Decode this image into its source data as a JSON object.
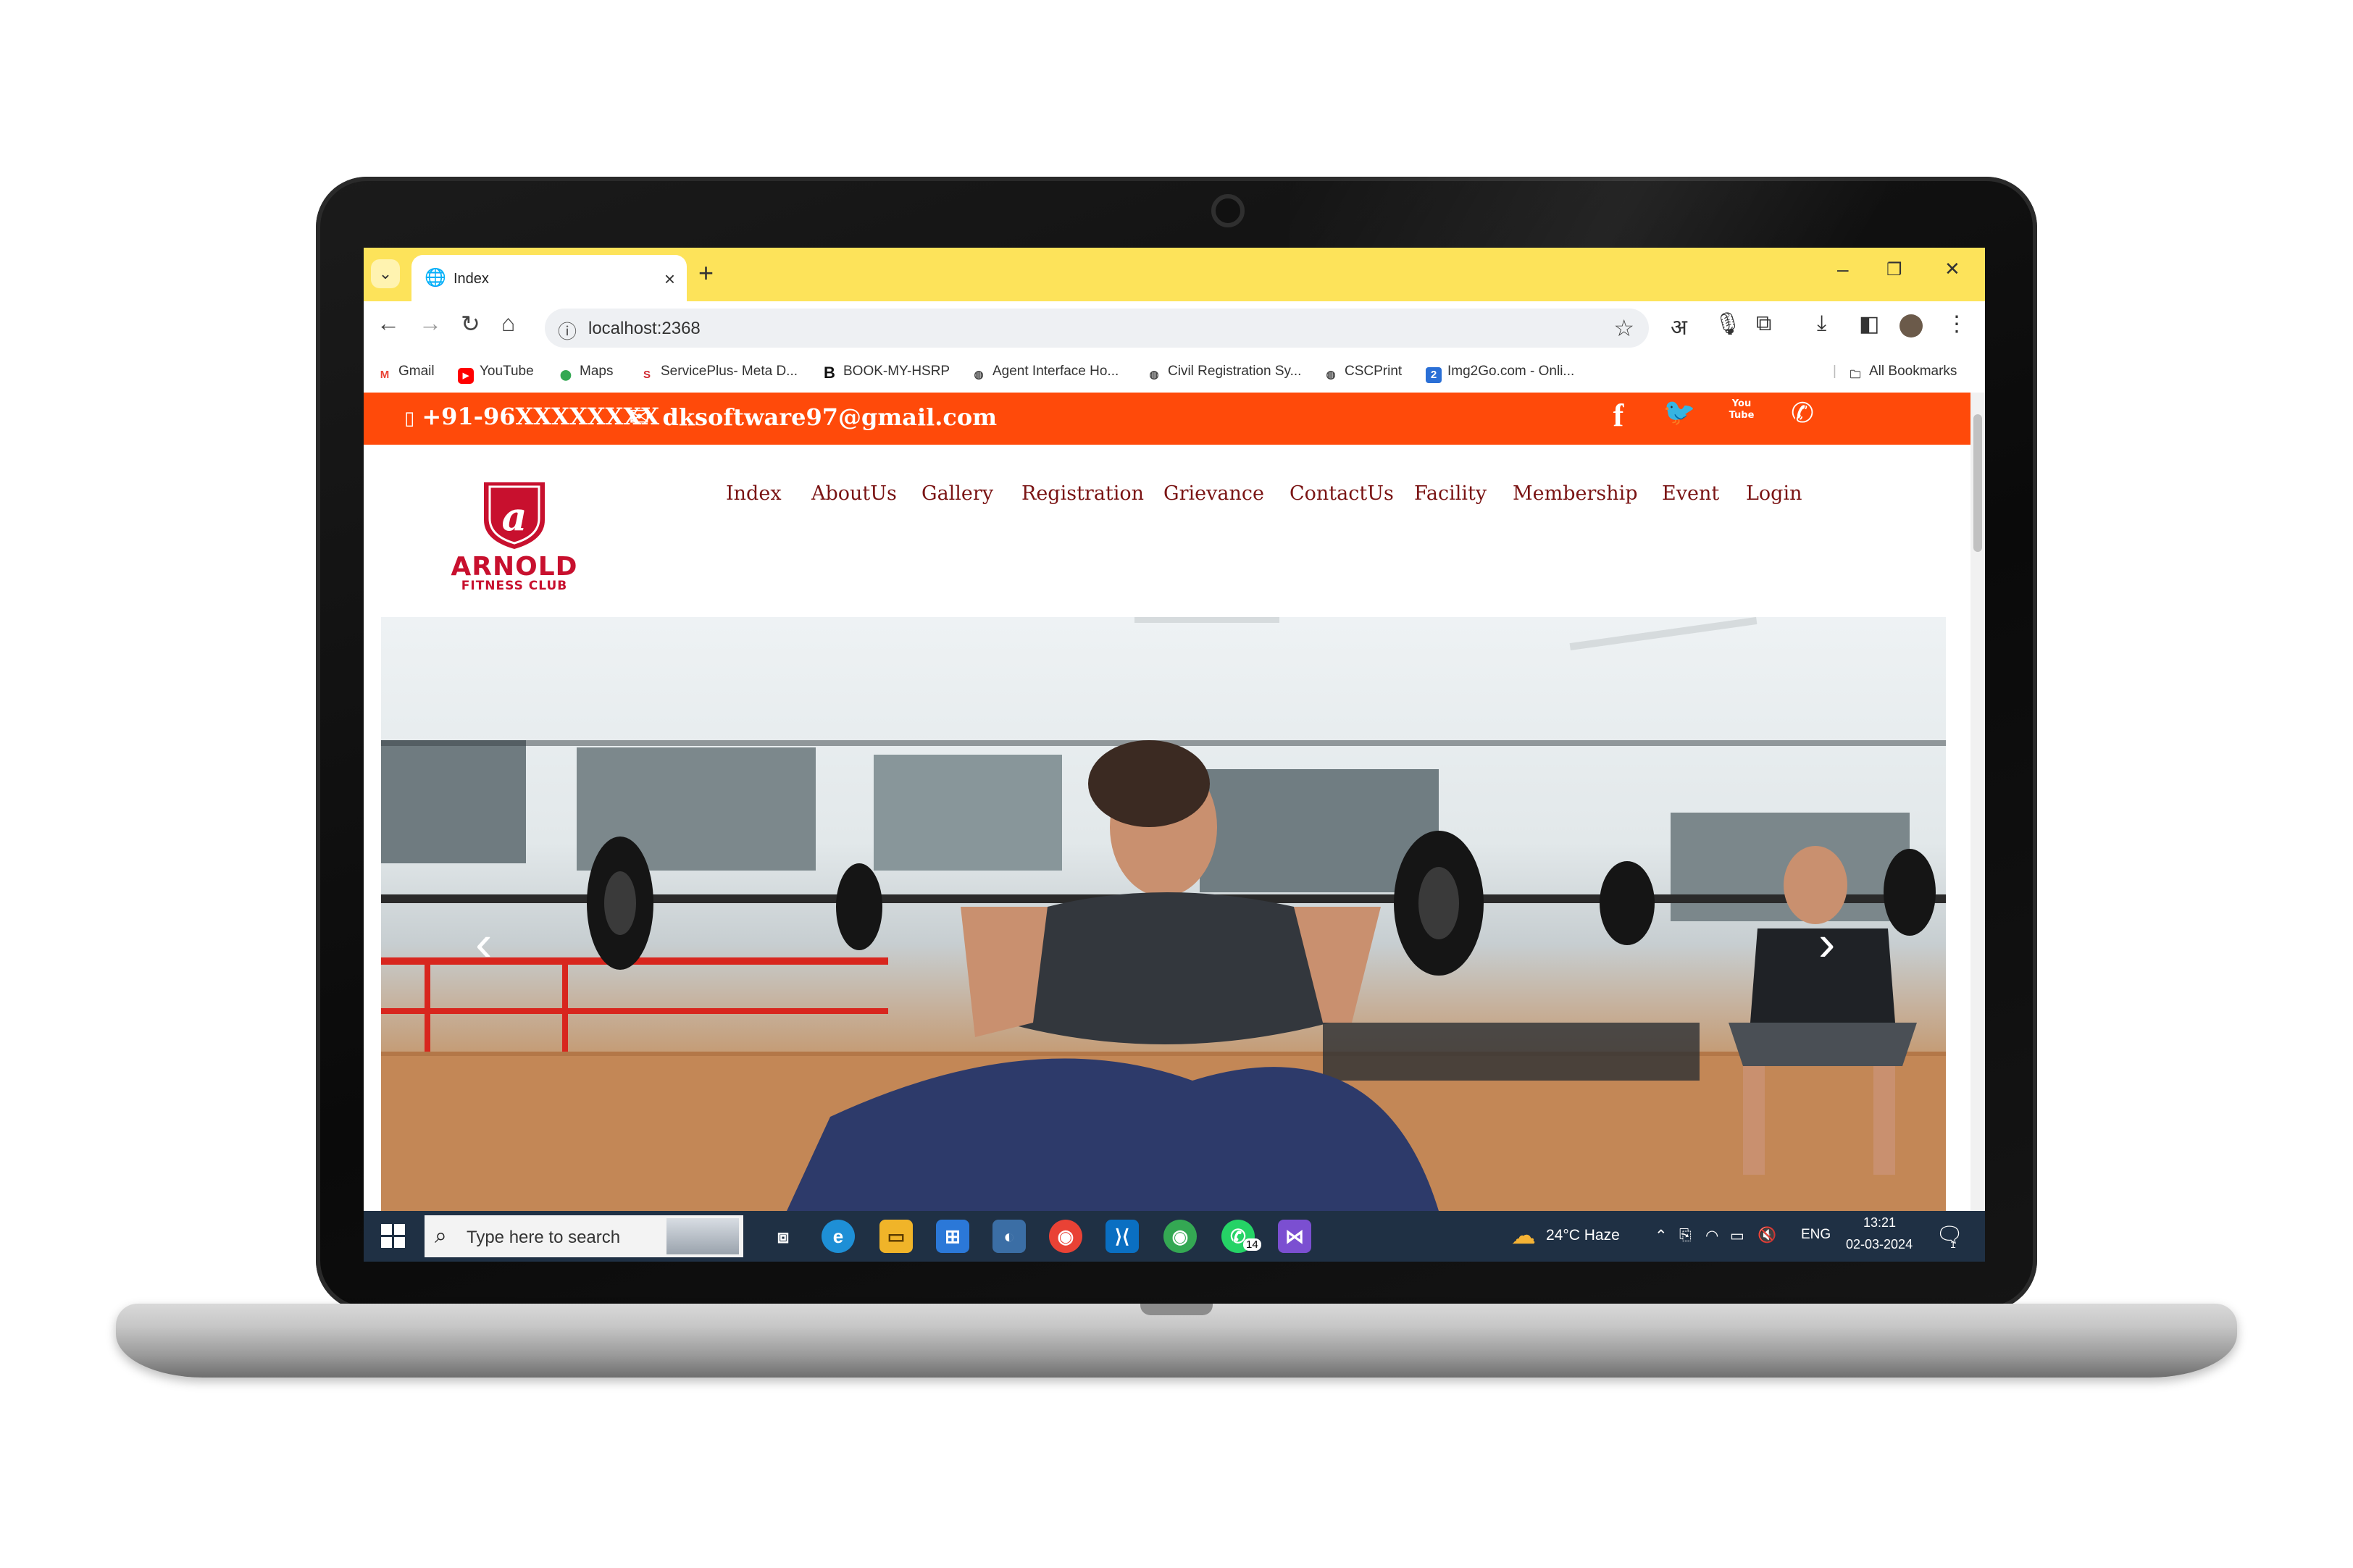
{
  "browser": {
    "tab_title": "Index",
    "new_tab_label": "+",
    "close_tab_label": "×",
    "url": "localhost:2368",
    "toolbar_letter": "अ",
    "window_controls": {
      "minimize": "–",
      "restore": "❐",
      "close": "✕"
    },
    "bookmarks": [
      {
        "label": "Gmail",
        "icon": "gmail-icon",
        "color": "#ea4335",
        "glyph": "M"
      },
      {
        "label": "YouTube",
        "icon": "youtube-icon",
        "color": "#ff0000",
        "glyph": "▶"
      },
      {
        "label": "Maps",
        "icon": "maps-icon",
        "color": "#34a853",
        "glyph": "⬤"
      },
      {
        "label": "ServicePlus- Meta D...",
        "icon": "serviceplus-icon",
        "color": "#d0262e",
        "glyph": "S"
      },
      {
        "label": "BOOK-MY-HSRP",
        "icon": "hsrp-icon",
        "color": "#111111",
        "glyph": "B"
      },
      {
        "label": "Agent Interface Ho...",
        "icon": "globe-icon",
        "color": "#444444",
        "glyph": "◍"
      },
      {
        "label": "Civil Registration Sy...",
        "icon": "globe-icon",
        "color": "#444444",
        "glyph": "◍"
      },
      {
        "label": "CSCPrint",
        "icon": "globe-icon",
        "color": "#444444",
        "glyph": "◍"
      },
      {
        "label": "Img2Go.com - Onli...",
        "icon": "img2go-icon",
        "color": "#2a6fd6",
        "glyph": "2"
      }
    ],
    "all_bookmarks_label": "All Bookmarks"
  },
  "site": {
    "phone": "+91-96XXXXXXXX",
    "email": "dksoftware97@gmail.com",
    "topbar_color": "#ff4a0a",
    "social": [
      {
        "name": "facebook-icon",
        "glyph": "f"
      },
      {
        "name": "twitter-icon",
        "glyph": "🐦"
      },
      {
        "name": "youtube-icon",
        "glyph": "You Tube"
      },
      {
        "name": "whatsapp-icon",
        "glyph": "✆"
      }
    ],
    "logo": {
      "line1": "ARNOLD",
      "line2": "FITNESS CLUB",
      "color": "#c8102e"
    },
    "nav": [
      "Index",
      "AboutUs",
      "Gallery",
      "Registration",
      "Grievance",
      "ContactUs",
      "Facility",
      "Membership",
      "Event",
      "Login"
    ],
    "nav_color": "#7a1414",
    "hero": {
      "prev_icon": "‹",
      "next_icon": "›"
    }
  },
  "taskbar": {
    "search_placeholder": "Type here to search",
    "weather": "24°C  Haze",
    "language": "ENG",
    "time": "13:21",
    "date": "02-03-2024",
    "whatsapp_badge": "14",
    "notification_badge": "1"
  }
}
